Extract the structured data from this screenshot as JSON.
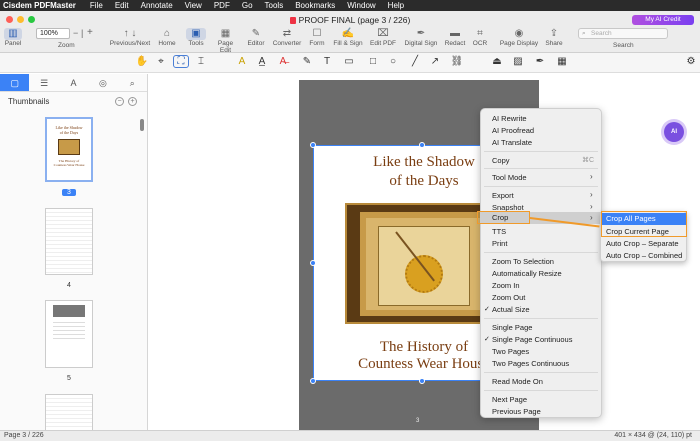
{
  "menubar": {
    "app": "Cisdem PDFMaster",
    "items": [
      "File",
      "Edit",
      "Annotate",
      "View",
      "PDF",
      "Go",
      "Tools",
      "Bookmarks",
      "Window",
      "Help"
    ]
  },
  "window": {
    "title": "PROOF FINAL (page 3 / 226)",
    "credit_label": "My AI Credit"
  },
  "toolbar": {
    "panel": "Panel",
    "zoom_value": "100%",
    "zoom_label": "Zoom",
    "prevnext": "Previous/Next",
    "home": "Home",
    "tools": "Tools",
    "page_edit": "Page Edit",
    "editor": "Editor",
    "converter": "Converter",
    "form": "Form",
    "fill_sign": "Fill & Sign",
    "edit_pdf": "Edit PDF",
    "digital_sign": "Digital Sign",
    "redact": "Redact",
    "ocr": "OCR",
    "page_display": "Page Display",
    "share": "Share",
    "search_placeholder": "Search",
    "search_label": "Search"
  },
  "sidebar": {
    "heading": "Thumbnails",
    "pages": [
      "3",
      "4",
      "5"
    ]
  },
  "document": {
    "title_line1": "Like the Shadow",
    "title_line2": "of the Days",
    "subtitle_line1": "The History of",
    "subtitle_line2": "Countess Wear House",
    "page_number": "3"
  },
  "context_menu": {
    "ai_rewrite": "AI Rewrite",
    "ai_proofread": "AI Proofread",
    "ai_translate": "AI Translate",
    "copy": "Copy",
    "copy_shortcut": "⌘C",
    "tool_mode": "Tool Mode",
    "export": "Export",
    "snapshot": "Snapshot",
    "crop": "Crop",
    "tts": "TTS",
    "print": "Print",
    "zoom_to_selection": "Zoom To Selection",
    "auto_resize": "Automatically Resize",
    "zoom_in": "Zoom In",
    "zoom_out": "Zoom Out",
    "actual_size": "Actual Size",
    "single_page": "Single Page",
    "single_page_cont": "Single Page Continuous",
    "two_pages": "Two Pages",
    "two_pages_cont": "Two Pages Continuous",
    "read_mode": "Read Mode On",
    "next_page": "Next Page",
    "prev_page": "Previous Page"
  },
  "crop_submenu": {
    "all": "Crop All Pages",
    "current": "Crop Current Page",
    "auto_sep": "Auto Crop – Separate",
    "auto_comb": "Auto Crop – Combined"
  },
  "status": {
    "page": "Page 3 / 226",
    "size": "401 × 434 @ (24, 110) pt"
  },
  "ai_float_label": "AI"
}
